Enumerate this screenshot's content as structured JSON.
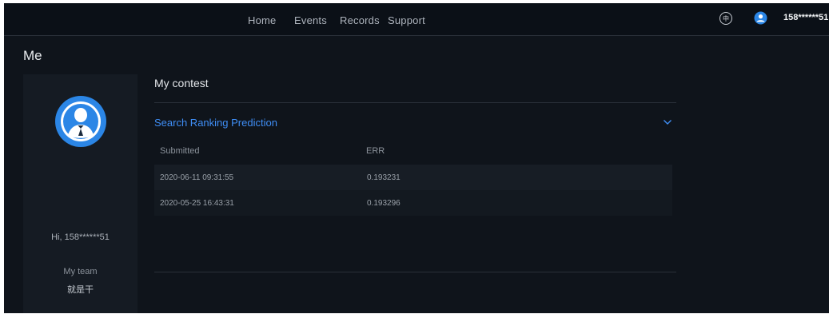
{
  "nav": {
    "items": [
      {
        "label": "Home"
      },
      {
        "label": "Events"
      },
      {
        "label": "Records"
      },
      {
        "label": "Support"
      }
    ],
    "lang_label": "中",
    "username": "158******51"
  },
  "page": {
    "title": "Me"
  },
  "profile": {
    "greeting": "Hi, 158******51",
    "team_label": "My team",
    "team_name": "就是干"
  },
  "contest": {
    "section_title": "My contest",
    "name": "Search Ranking Prediction",
    "table": {
      "headers": [
        "Submitted",
        "ERR"
      ],
      "rows": [
        [
          "2020-06-11 09:31:55",
          "0.193231"
        ],
        [
          "2020-05-25 16:43:31",
          "0.193296"
        ]
      ]
    }
  },
  "colors": {
    "background": "#0f141b",
    "accent": "#3f8ef6",
    "avatar_blue": "#2b86e6"
  },
  "icons": {
    "language": "language-toggle-icon",
    "user": "user-avatar-icon",
    "expand": "chevron-down-icon"
  }
}
